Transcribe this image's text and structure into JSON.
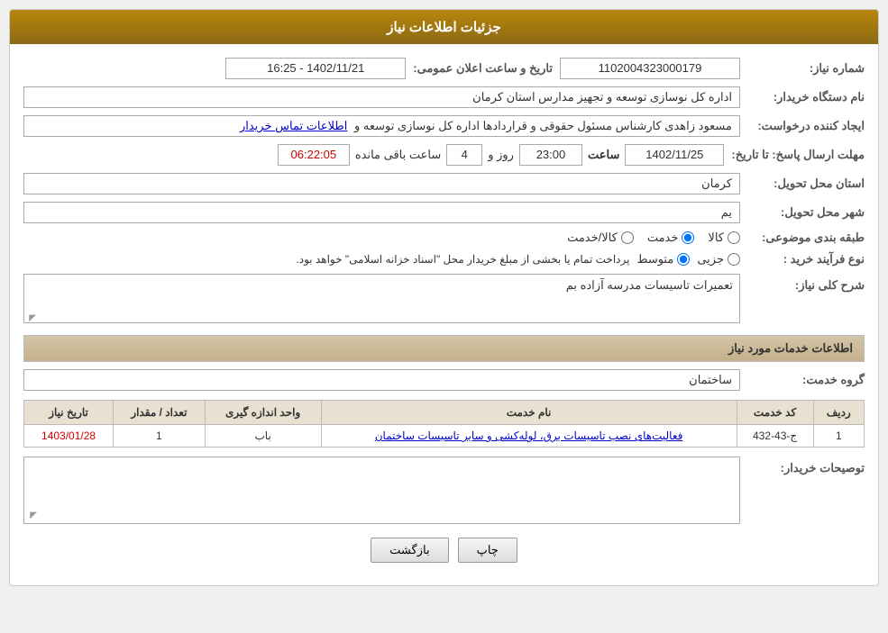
{
  "header": {
    "title": "جزئیات اطلاعات نیاز"
  },
  "fields": {
    "need_number_label": "شماره نیاز:",
    "need_number_value": "1102004323000179",
    "announce_datetime_label": "تاریخ و ساعت اعلان عمومی:",
    "announce_datetime_value": "1402/11/21 - 16:25",
    "buyer_org_label": "نام دستگاه خریدار:",
    "buyer_org_value": "اداره کل نوسازی  توسعه و تجهیز مدارس استان کرمان",
    "creator_label": "ایجاد کننده درخواست:",
    "creator_value": "مسعود زاهدی کارشناس مسئول حقوقی و قراردادها اداره کل نوسازی  توسعه و",
    "creator_link": "اطلاعات تماس خریدار",
    "deadline_label": "مهلت ارسال پاسخ: تا تاریخ:",
    "deadline_date": "1402/11/25",
    "deadline_time_label": "ساعت",
    "deadline_time": "23:00",
    "deadline_day_label": "روز و",
    "deadline_days": "4",
    "deadline_remaining_label": "ساعت باقی مانده",
    "deadline_remaining": "06:22:05",
    "province_label": "استان محل تحویل:",
    "province_value": "کرمان",
    "city_label": "شهر محل تحویل:",
    "city_value": "یم",
    "category_label": "طبقه بندی موضوعی:",
    "category_options": [
      {
        "id": "kala",
        "label": "کالا"
      },
      {
        "id": "khadamat",
        "label": "خدمت"
      },
      {
        "id": "kala_khadamat",
        "label": "کالا/خدمت"
      }
    ],
    "category_selected": "khadamat",
    "purchase_type_label": "نوع فرآیند خرید :",
    "purchase_type_options": [
      {
        "id": "jozvi",
        "label": "جزیی"
      },
      {
        "id": "motavasset",
        "label": "متوسط"
      }
    ],
    "purchase_type_selected": "motavasset",
    "purchase_type_note": "پرداخت تمام یا بخشی از مبلغ خریدار محل \"اسناد خزانه اسلامی\" خواهد بود.",
    "description_label": "شرح کلی نیاز:",
    "description_value": "تعمیرات تاسیسات مدرسه آزاده بم",
    "services_section_label": "اطلاعات خدمات مورد نیاز",
    "service_group_label": "گروه خدمت:",
    "service_group_value": "ساختمان",
    "table": {
      "headers": [
        "ردیف",
        "کد خدمت",
        "نام خدمت",
        "واحد اندازه گیری",
        "تعداد / مقدار",
        "تاریخ نیاز"
      ],
      "rows": [
        {
          "row_num": "1",
          "service_code": "ج-43-432",
          "service_name": "فعالیت‌های نصب تاسیسات برق، لوله‌کشی و سایر تاسیسات ساختمان",
          "unit": "باب",
          "quantity": "1",
          "need_date": "1403/01/28"
        }
      ]
    },
    "buyer_notes_label": "توصیحات خریدار:"
  },
  "buttons": {
    "print_label": "چاپ",
    "back_label": "بازگشت"
  }
}
